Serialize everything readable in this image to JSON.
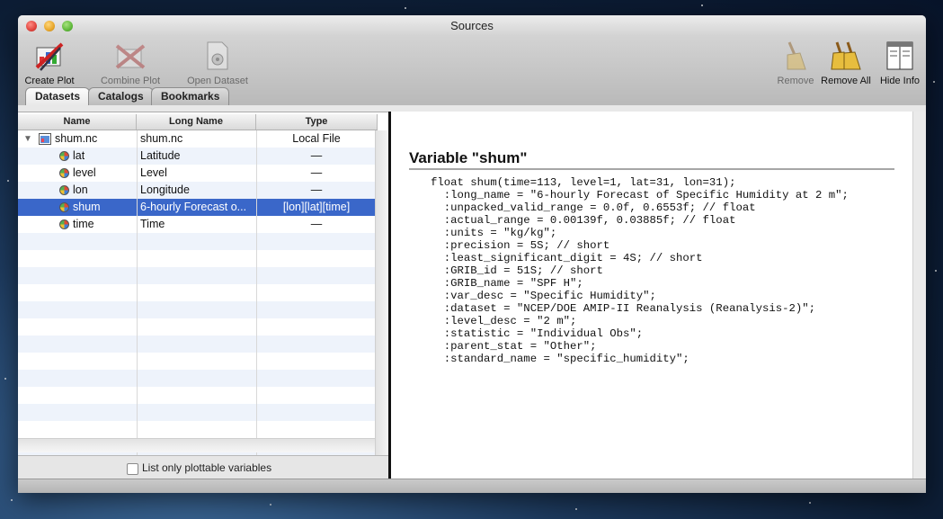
{
  "window": {
    "title": "Sources"
  },
  "toolbar": {
    "create_plot": "Create Plot",
    "combine_plot": "Combine Plot",
    "open_dataset": "Open Dataset",
    "remove": "Remove",
    "remove_all": "Remove All",
    "hide_info": "Hide Info"
  },
  "tabs": [
    "Datasets",
    "Catalogs",
    "Bookmarks"
  ],
  "table": {
    "columns": [
      "Name",
      "Long Name",
      "Type"
    ],
    "rows": [
      {
        "name": "shum.nc",
        "long_name": "shum.nc",
        "type": "Local File"
      },
      {
        "name": "lat",
        "long_name": "Latitude",
        "type": "—"
      },
      {
        "name": "level",
        "long_name": "Level",
        "type": "—"
      },
      {
        "name": "lon",
        "long_name": "Longitude",
        "type": "—"
      },
      {
        "name": "shum",
        "long_name": "6-hourly Forecast o...",
        "type": "[lon][lat][time]"
      },
      {
        "name": "time",
        "long_name": "Time",
        "type": "—"
      }
    ]
  },
  "filter": {
    "label": "List only plottable variables",
    "checked": false
  },
  "detail": {
    "title": "Variable \"shum\"",
    "lines": [
      "float shum(time=113, level=1, lat=31, lon=31);",
      "  :long_name = \"6-hourly Forecast of Specific Humidity at 2 m\";",
      "  :unpacked_valid_range = 0.0f, 0.6553f; // float",
      "  :actual_range = 0.00139f, 0.03885f; // float",
      "  :units = \"kg/kg\";",
      "  :precision = 5S; // short",
      "  :least_significant_digit = 4S; // short",
      "  :GRIB_id = 51S; // short",
      "  :GRIB_name = \"SPF H\";",
      "  :var_desc = \"Specific Humidity\";",
      "  :dataset = \"NCEP/DOE AMIP-II Reanalysis (Reanalysis-2)\";",
      "  :level_desc = \"2 m\";",
      "  :statistic = \"Individual Obs\";",
      "  :parent_stat = \"Other\";",
      "  :standard_name = \"specific_humidity\";"
    ]
  }
}
